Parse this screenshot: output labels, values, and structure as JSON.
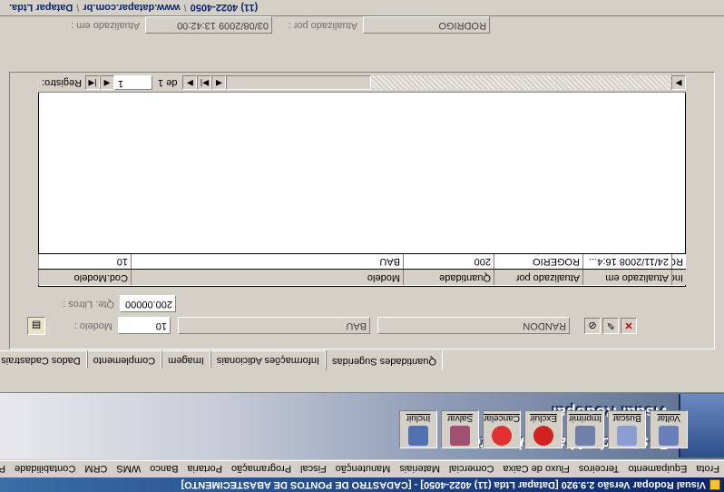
{
  "window": {
    "title": "Visual Rodopar Versão 2.9.920 [Datapar Ltda (11) 4022-4050] - [CADASTRO DE PONTOS DE ABASTECIMENTO]"
  },
  "menu": {
    "items": [
      "Frota",
      "Equipamento",
      "Terceiros",
      "Fluxo de Caixa",
      "Comercial",
      "Materiais",
      "Manutenção",
      "Fiscal",
      "Programação",
      "Portaria",
      "Banco",
      "WMS",
      "CRM",
      "Contabilidade",
      "P"
    ]
  },
  "banner": {
    "title": "Visual Rodopar",
    "subtitle": "Postos de Abastecimento"
  },
  "toolbar": {
    "buttons": [
      {
        "label": "Incluir",
        "icon": "add-icon"
      },
      {
        "label": "Salvar",
        "icon": "save-icon"
      },
      {
        "label": "Cancelar",
        "icon": "cancel-icon"
      },
      {
        "label": "Excluir",
        "icon": "delete-icon"
      },
      {
        "label": "Imprimir",
        "icon": "print-icon"
      },
      {
        "label": "Buscar",
        "icon": "search-icon"
      },
      {
        "label": "Voltar",
        "icon": "back-icon"
      }
    ]
  },
  "tabs": [
    "Dados Cadastrais",
    "Complemento",
    "Imagem",
    "Informações Adicionais",
    "Quantidades Sugeridas"
  ],
  "active_tab": "Quantidades Sugeridas",
  "form": {
    "modelo_label": "Modelo :",
    "modelo_code": "10",
    "modelo_name": "BAU",
    "modelo_brand": "RANDON",
    "qtde_litros_label": "Qte. Litros :",
    "qtde_litros_value": "200.00000"
  },
  "grid": {
    "columns": [
      "Cod.Modelo",
      "Modelo",
      "Quantidade",
      "Atualizado por",
      "Atualizado em",
      "Inc"
    ],
    "rows": [
      [
        "10",
        "BAU",
        "200",
        "ROGERIO",
        "24/11/2008 16:4...",
        "RO"
      ]
    ]
  },
  "navigator": {
    "label": "Registro:",
    "current": "1",
    "of_text": "de 1"
  },
  "audit": {
    "updated_by_label": "Atualizado por :",
    "updated_by": "RODRIGO",
    "updated_at_label": "Atualizado em :",
    "updated_at": "03/08/2009 13:42:00"
  },
  "footer": {
    "company": "Datapar Ltda.",
    "site": "www.datapar.com.br",
    "phone": "(11) 4022-4050"
  }
}
